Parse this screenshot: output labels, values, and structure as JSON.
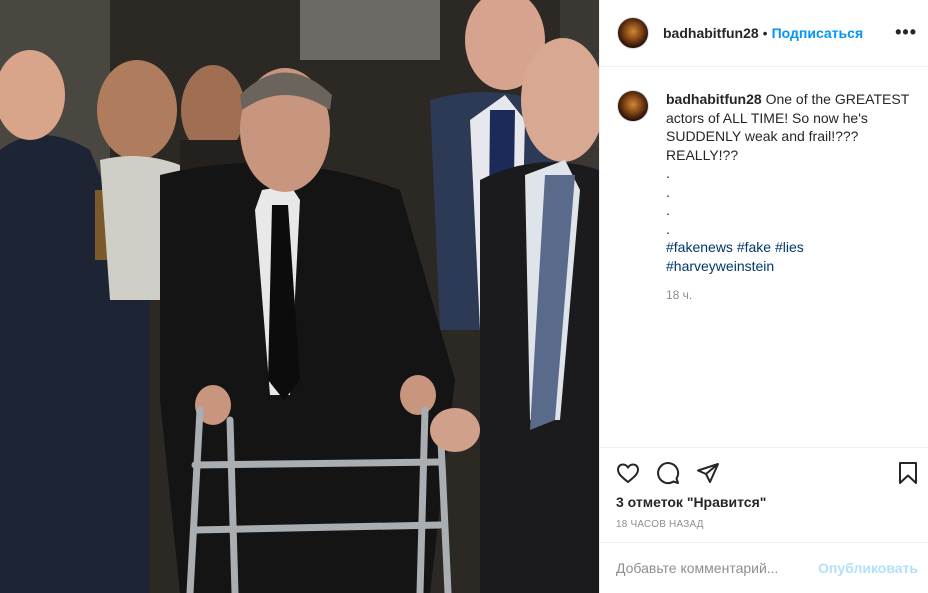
{
  "post": {
    "username": "badhabitfun28",
    "dot": "•",
    "follow_label": "Подписаться",
    "more_label": "•••"
  },
  "caption": {
    "username": "badhabitfun28",
    "line1": "One of the GREATEST",
    "line2": "actors of ALL TIME! So now he's",
    "line3": "SUDDENLY weak and frail!???",
    "line4": "REALLY!??",
    "dots": [
      ".",
      ".",
      ".",
      "."
    ],
    "hashtags_line1": [
      "#fakenews",
      "#fake",
      "#lies"
    ],
    "hashtags_line2": [
      "#harveyweinstein"
    ],
    "time": "18 ч."
  },
  "actions": {
    "icons": [
      "heart-icon",
      "comment-icon",
      "share-icon",
      "bookmark-icon"
    ],
    "likes_text": "3 отметок \"Нравится\"",
    "posted_ago": "18 ЧАСОВ НАЗАД"
  },
  "comment": {
    "placeholder": "Добавьте комментарий...",
    "publish_label": "Опубликовать"
  },
  "colors": {
    "accent": "#0095f6",
    "hashtag": "#00376b",
    "muted": "#8e8e8e",
    "publish_disabled": "#b2dffc"
  }
}
